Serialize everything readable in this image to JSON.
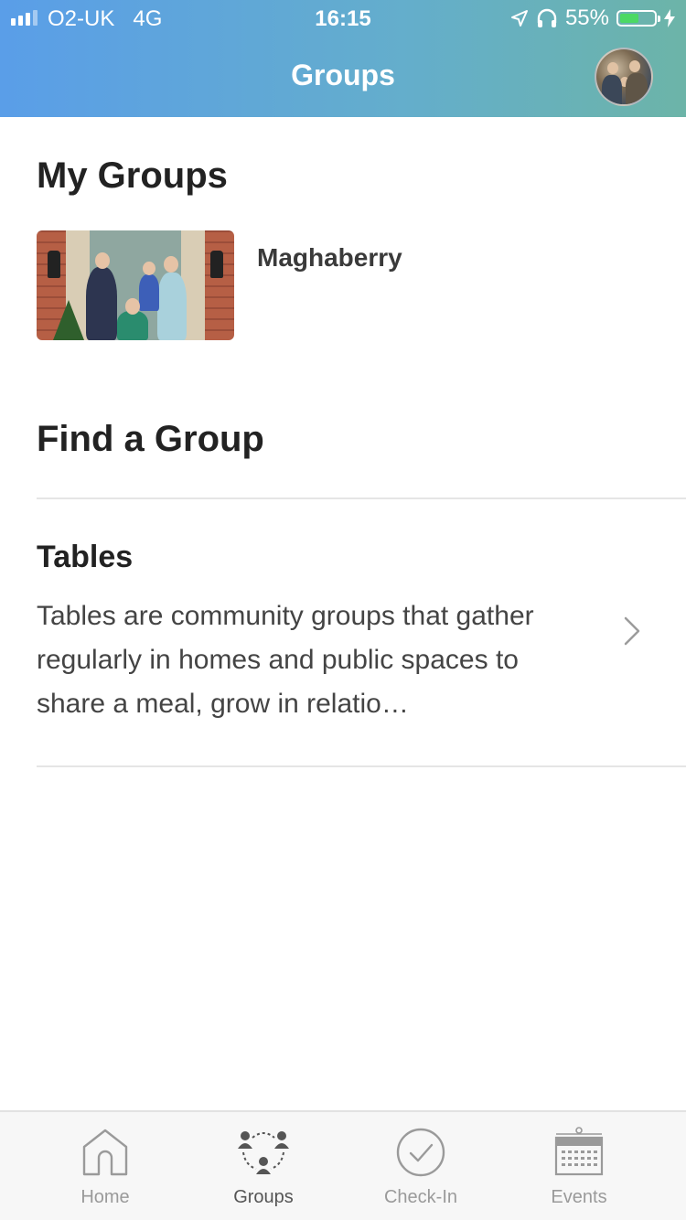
{
  "status_bar": {
    "carrier": "O2-UK",
    "network": "4G",
    "time": "16:15",
    "battery_percent": "55%",
    "battery_level": 0.55,
    "icons": [
      "location-arrow-icon",
      "headphones-icon",
      "battery-icon",
      "charging-bolt-icon"
    ]
  },
  "header": {
    "title": "Groups",
    "avatar_icon": "profile-avatar"
  },
  "my_groups": {
    "title": "My Groups",
    "items": [
      {
        "name": "Maghaberry",
        "image": "family-photo"
      }
    ]
  },
  "find_group": {
    "title": "Find a Group",
    "categories": [
      {
        "title": "Tables",
        "description": "Tables are community groups that gather regularly in homes and public spaces to share a meal, grow in relatio…",
        "icon": "chevron-right-icon"
      }
    ]
  },
  "tabbar": {
    "tabs": [
      {
        "label": "Home",
        "icon": "home-icon",
        "active": false
      },
      {
        "label": "Groups",
        "icon": "groups-icon",
        "active": true
      },
      {
        "label": "Check-In",
        "icon": "check-circle-icon",
        "active": false
      },
      {
        "label": "Events",
        "icon": "calendar-icon",
        "active": false
      }
    ]
  },
  "colors": {
    "header_gradient_start": "#5a9ee8",
    "header_gradient_end": "#6cb4a8",
    "battery_fill": "#4cd964",
    "tab_inactive": "#9a9a9a",
    "tab_active": "#555555"
  }
}
